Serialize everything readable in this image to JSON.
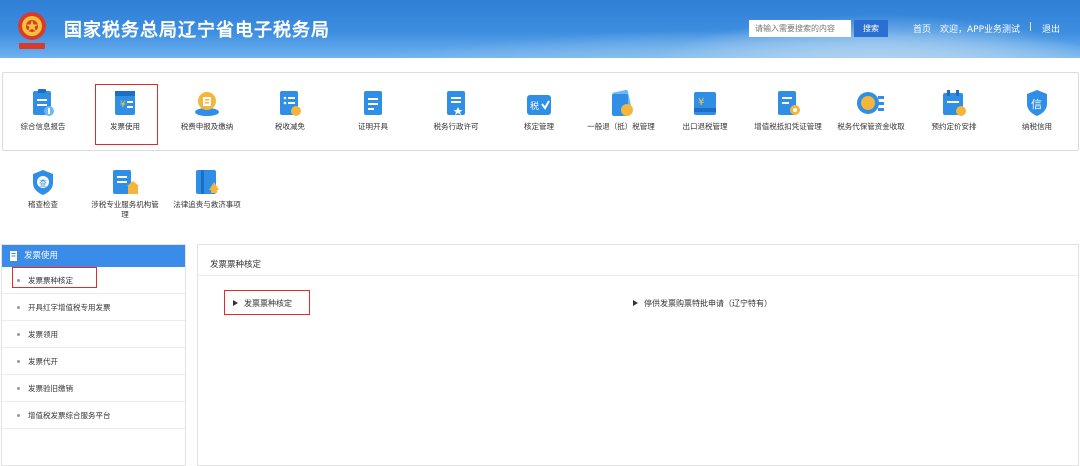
{
  "header": {
    "title": "国家税务总局辽宁省电子税务局",
    "search_placeholder": "请输入需要搜索的内容",
    "search_button": "搜索",
    "nav_home": "首页",
    "nav_welcome": "欢迎，APP业务测试",
    "nav_sep": "|",
    "nav_logout": "退出"
  },
  "services": [
    {
      "label": "综合信息报告",
      "icon": "report-icon"
    },
    {
      "label": "发票使用",
      "icon": "invoice-icon"
    },
    {
      "label": "税费申报及缴纳",
      "icon": "declare-pay-icon"
    },
    {
      "label": "税收减免",
      "icon": "tax-reduction-icon"
    },
    {
      "label": "证明开具",
      "icon": "certificate-icon"
    },
    {
      "label": "税务行政许可",
      "icon": "admin-permit-icon"
    },
    {
      "label": "核定管理",
      "icon": "assessment-icon"
    },
    {
      "label": "一般退（抵）税管理",
      "icon": "refund-icon"
    },
    {
      "label": "出口退税管理",
      "icon": "export-refund-icon"
    },
    {
      "label": "增值税抵扣凭证管理",
      "icon": "vat-deduction-icon"
    },
    {
      "label": "税务代保管资金收取",
      "icon": "custody-fund-icon"
    },
    {
      "label": "预约定价安排",
      "icon": "pricing-arrangement-icon"
    },
    {
      "label": "纳税信用",
      "icon": "credit-icon"
    },
    {
      "label": "稽查检查",
      "icon": "inspection-icon"
    },
    {
      "label": "涉税专业服务机构管理",
      "icon": "service-agency-icon"
    },
    {
      "label": "法律追责与救济事项",
      "icon": "legal-relief-icon"
    }
  ],
  "sidebar": {
    "title": "发票使用",
    "items": [
      {
        "label": "发票票种核定"
      },
      {
        "label": "开具红字增值税专用发票"
      },
      {
        "label": "发票领用"
      },
      {
        "label": "发票代开"
      },
      {
        "label": "发票验旧缴销"
      },
      {
        "label": "增值税发票综合服务平台"
      }
    ]
  },
  "main": {
    "title": "发票票种核定",
    "links": [
      {
        "label": "发票票种核定"
      },
      {
        "label": "停供发票购票特批申请（辽宁特有）"
      }
    ]
  },
  "colors": {
    "header_blue": "#3d8ee0",
    "accent_blue": "#3b8be8",
    "highlight_red": "#e02b2b",
    "icon_blue": "#2f8ee6"
  }
}
